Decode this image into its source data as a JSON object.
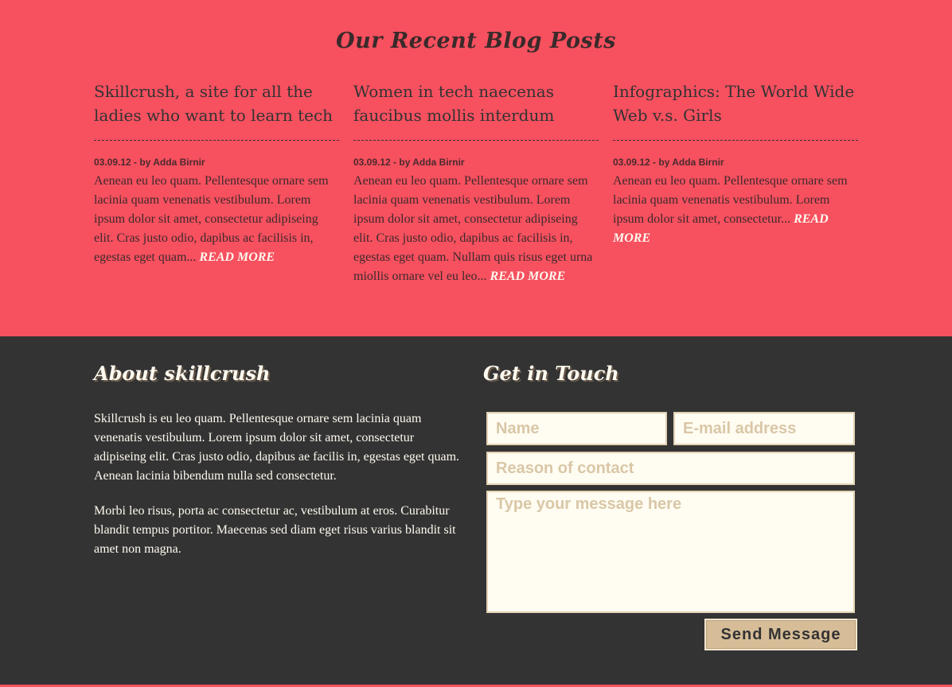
{
  "blog": {
    "heading": "Our Recent Blog Posts",
    "posts": [
      {
        "title": "Skillcrush, a site for all the ladies who want to learn tech",
        "meta": "03.09.12 - by Adda Birnir",
        "excerpt": "Aenean eu leo quam. Pellentesque ornare sem lacinia quam venenatis vestibulum. Lorem ipsum dolor sit amet, consectetur adipiseing elit. Cras justo odio, dapibus ac facilisis in, egestas eget quam...",
        "read_more": "READ MORE"
      },
      {
        "title": "Women in tech naecenas faucibus mollis interdum",
        "meta": "03.09.12 - by Adda Birnir",
        "excerpt": "Aenean eu leo quam. Pellentesque ornare sem lacinia quam venenatis vestibulum. Lorem ipsum dolor sit amet, consectetur adipiseing elit. Cras justo odio, dapibus ac facilisis in, egestas eget quam. Nullam quis risus eget urna miollis ornare vel eu leo...",
        "read_more": "READ MORE"
      },
      {
        "title": "Infographics: The World Wide Web v.s. Girls",
        "meta": "03.09.12 - by Adda Birnir",
        "excerpt": "Aenean eu leo quam. Pellentesque ornare sem lacinia quam venenatis vestibulum. Lorem ipsum dolor sit amet, consectetur...",
        "read_more": "READ MORE"
      }
    ]
  },
  "about": {
    "heading": "About skillcrush",
    "paragraphs": [
      "Skillcrush is eu leo quam. Pellentesque ornare sem lacinia quam venenatis vestibulum. Lorem ipsum dolor sit amet, consectetur adipiseing elit. Cras justo odio, dapibus ae facilis in, egestas eget quam. Aenean lacinia bibendum nulla sed consectetur.",
      "Morbi leo risus, porta ac consectetur ac, vestibulum at eros. Curabitur blandit tempus portitor. Maecenas sed diam eget risus varius blandit sit amet non magna."
    ]
  },
  "contact": {
    "heading": "Get in Touch",
    "name_placeholder": "Name",
    "email_placeholder": "E-mail address",
    "reason_placeholder": "Reason of contact",
    "message_placeholder": "Type your message here",
    "send_label": "Send Message"
  },
  "colors": {
    "blog_bg": "#f7505f",
    "footer_bg": "#333333",
    "cream": "#fffaf0",
    "button_tan": "#d6bd97"
  }
}
